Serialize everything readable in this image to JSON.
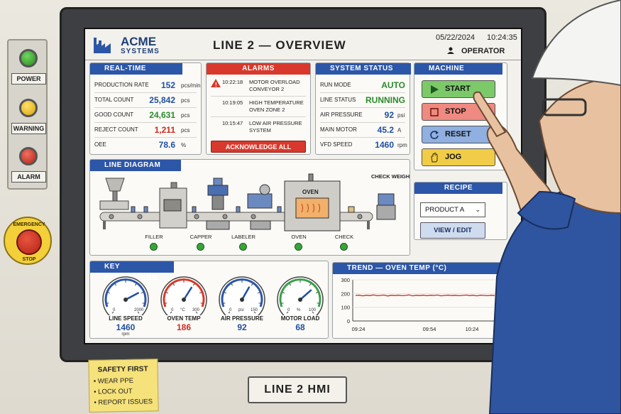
{
  "indicators": [
    {
      "label": "POWER",
      "color": "#34a033"
    },
    {
      "label": "WARNING",
      "color": "#f0c020"
    },
    {
      "label": "ALARM",
      "color": "#d8392c"
    }
  ],
  "estop": {
    "top": "EMERGENCY",
    "bottom": "STOP"
  },
  "header": {
    "brand_title": "ACME",
    "brand_sub": "SYSTEMS",
    "page_title": "LINE 2 — OVERVIEW",
    "date": "05/22/2024",
    "time": "10:24:35",
    "user": "OPERATOR"
  },
  "realtime": {
    "title": "REAL-TIME DATA",
    "rows": [
      {
        "label": "PRODUCTION RATE",
        "value": "152",
        "unit": "pcs/min",
        "color": "#1f4fa3"
      },
      {
        "label": "TOTAL COUNT",
        "value": "25,842",
        "unit": "pcs",
        "color": "#1f4fa3"
      },
      {
        "label": "GOOD COUNT",
        "value": "24,631",
        "unit": "pcs",
        "color": "#2b8a2b"
      },
      {
        "label": "REJECT COUNT",
        "value": "1,211",
        "unit": "pcs",
        "color": "#cc2a1f"
      },
      {
        "label": "OEE",
        "value": "78.6",
        "unit": "%",
        "color": "#1f4fa3"
      }
    ]
  },
  "alarms": {
    "title": "ALARMS",
    "items": [
      {
        "time": "10:22:18",
        "message": "MOTOR OVERLOAD CONVEYOR 2"
      },
      {
        "time": "10:19:05",
        "message": "HIGH TEMPERATURE OVEN ZONE 2"
      },
      {
        "time": "10:15:47",
        "message": "LOW AIR PRESSURE SYSTEM"
      }
    ],
    "ack_label": "ACKNOWLEDGE ALL"
  },
  "status": {
    "title": "SYSTEM STATUS",
    "rows": [
      {
        "label": "RUN MODE",
        "value": "AUTO",
        "unit": "",
        "color": "#2b8a2b"
      },
      {
        "label": "LINE STATUS",
        "value": "RUNNING",
        "unit": "",
        "color": "#2b8a2b"
      },
      {
        "label": "AIR PRESSURE",
        "value": "92",
        "unit": "psi",
        "color": "#1f4fa3"
      },
      {
        "label": "MAIN MOTOR",
        "value": "45.2",
        "unit": "A",
        "color": "#1f4fa3"
      },
      {
        "label": "VFD SPEED",
        "value": "1460",
        "unit": "rpm",
        "color": "#1f4fa3"
      }
    ]
  },
  "controls": {
    "title": "MACHINE CONTROLS",
    "buttons": [
      {
        "label": "START",
        "icon": "play-icon",
        "color": "#7cc96a"
      },
      {
        "label": "STOP",
        "icon": "stop-icon",
        "color": "#ef8a80"
      },
      {
        "label": "RESET",
        "icon": "reset-icon",
        "color": "#8fb0e0"
      },
      {
        "label": "JOG",
        "icon": "hand-icon",
        "color": "#f0cc48"
      }
    ]
  },
  "recipe": {
    "title": "RECIPE",
    "selected": "PRODUCT A",
    "view_label": "VIEW / EDIT"
  },
  "diagram": {
    "title": "LINE DIAGRAM",
    "stations": [
      {
        "label": "FILLER"
      },
      {
        "label": "CAPPER"
      },
      {
        "label": "LABELER"
      },
      {
        "label": "OVEN"
      },
      {
        "label": "CHECK"
      }
    ],
    "oven_text": "OVEN",
    "check_weigher_text": "CHECK WEIGHER",
    "status_color": "#38a43a"
  },
  "parameters": {
    "title": "KEY PARAMETERS",
    "gauges": [
      {
        "label": "LINE SPEED",
        "value": "1460",
        "unit": "rpm",
        "min": "0",
        "max": "2000",
        "mid": "",
        "color": "#1f4fa3",
        "arc": "#2c56a8",
        "level": 0.73
      },
      {
        "label": "OVEN TEMP",
        "value": "186",
        "unit": "",
        "min": "0",
        "max": "300",
        "mid": "°C",
        "color": "#cc2a1f",
        "arc": "#d8392c",
        "level": 0.62
      },
      {
        "label": "AIR PRESSURE",
        "value": "92",
        "unit": "",
        "min": "0",
        "max": "150",
        "mid": "psi",
        "color": "#1f4fa3",
        "arc": "#2c56a8",
        "level": 0.61
      },
      {
        "label": "MOTOR LOAD",
        "value": "68",
        "unit": "",
        "min": "0",
        "max": "100",
        "mid": "%",
        "color": "#1f4fa3",
        "arc": "#3aa04a",
        "level": 0.68
      }
    ]
  },
  "trend": {
    "title": "TREND — OVEN TEMP (°C)"
  },
  "chart_data": {
    "type": "line",
    "title": "TREND — OVEN TEMP (°C)",
    "x_ticks": [
      "09:24",
      "09:54",
      "10:24"
    ],
    "y_ticks": [
      "0",
      "100",
      "200",
      "300"
    ],
    "ylim": [
      0,
      300
    ],
    "series": [
      {
        "color": "#cc2a1f",
        "values": [
          186,
          188,
          183,
          187,
          185,
          190,
          184,
          186,
          189,
          182,
          187,
          185,
          188,
          184,
          186,
          190,
          183,
          187,
          185,
          188,
          184,
          187,
          186,
          189,
          183,
          186,
          188,
          185,
          187,
          184,
          186,
          189,
          185,
          187,
          183,
          188,
          186,
          184,
          187,
          185
        ]
      }
    ]
  },
  "panel_label": "LINE 2 HMI",
  "note": {
    "title": "SAFETY FIRST",
    "items": [
      "• WEAR PPE",
      "• LOCK OUT",
      "• REPORT ISSUES"
    ]
  }
}
